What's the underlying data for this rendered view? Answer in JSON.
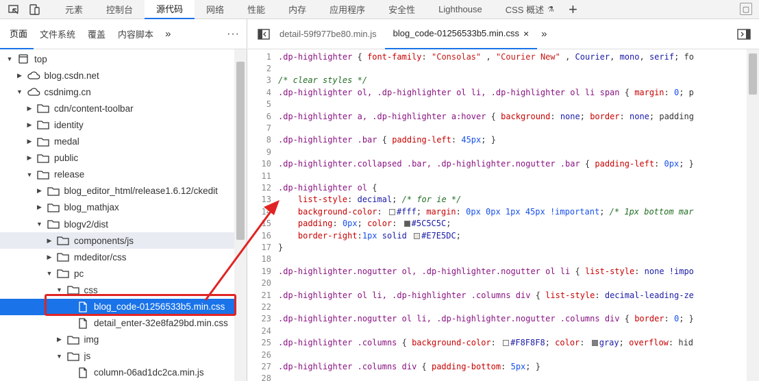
{
  "topbar": {
    "tabs": [
      "元素",
      "控制台",
      "源代码",
      "网络",
      "性能",
      "内存",
      "应用程序",
      "安全性",
      "Lighthouse",
      "CSS 概述"
    ],
    "active_tab": 2,
    "plus": "+"
  },
  "left": {
    "subtabs": [
      "页面",
      "文件系统",
      "覆盖",
      "内容脚本"
    ],
    "chevron": "»",
    "dots": "⋮"
  },
  "tree": [
    {
      "label": "top",
      "indent": 0,
      "tri": "open",
      "icon": "frame"
    },
    {
      "label": "blog.csdn.net",
      "indent": 1,
      "tri": "closed",
      "icon": "cloud"
    },
    {
      "label": "csdnimg.cn",
      "indent": 1,
      "tri": "open",
      "icon": "cloud"
    },
    {
      "label": "cdn/content-toolbar",
      "indent": 2,
      "tri": "closed",
      "icon": "folder"
    },
    {
      "label": "identity",
      "indent": 2,
      "tri": "closed",
      "icon": "folder"
    },
    {
      "label": "medal",
      "indent": 2,
      "tri": "closed",
      "icon": "folder"
    },
    {
      "label": "public",
      "indent": 2,
      "tri": "closed",
      "icon": "folder"
    },
    {
      "label": "release",
      "indent": 2,
      "tri": "open",
      "icon": "folder"
    },
    {
      "label": "blog_editor_html/release1.6.12/ckedit",
      "indent": 3,
      "tri": "closed",
      "icon": "folder"
    },
    {
      "label": "blog_mathjax",
      "indent": 3,
      "tri": "closed",
      "icon": "folder"
    },
    {
      "label": "blogv2/dist",
      "indent": 3,
      "tri": "open",
      "icon": "folder"
    },
    {
      "label": "components/js",
      "indent": 4,
      "tri": "closed",
      "icon": "folder",
      "state": "hl"
    },
    {
      "label": "mdeditor/css",
      "indent": 4,
      "tri": "closed",
      "icon": "folder"
    },
    {
      "label": "pc",
      "indent": 4,
      "tri": "open",
      "icon": "folder"
    },
    {
      "label": "css",
      "indent": 5,
      "tri": "open",
      "icon": "folder"
    },
    {
      "label": "blog_code-01256533b5.min.css",
      "indent": 6,
      "tri": "none",
      "icon": "file",
      "state": "sel"
    },
    {
      "label": "detail_enter-32e8fa29bd.min.css",
      "indent": 6,
      "tri": "none",
      "icon": "file"
    },
    {
      "label": "img",
      "indent": 5,
      "tri": "closed",
      "icon": "folder"
    },
    {
      "label": "js",
      "indent": 5,
      "tri": "open",
      "icon": "folder"
    },
    {
      "label": "column-06ad1dc2ca.min.js",
      "indent": 6,
      "tri": "none",
      "icon": "file"
    }
  ],
  "filetabs": {
    "inactive": "detail-59f977be80.min.js",
    "active": "blog_code-01256533b5.min.css",
    "close": "×",
    "chevron": "»"
  },
  "code_lines": [
    {
      "n": "1",
      "t": [
        [
          "sel-c",
          ".dp-highlighter"
        ],
        [
          "code",
          " { "
        ],
        [
          "prop",
          "font-family"
        ],
        [
          "code",
          ": "
        ],
        [
          "str",
          "\"Consolas\""
        ],
        [
          "code",
          " , "
        ],
        [
          "str",
          "\"Courier New\""
        ],
        [
          "code",
          " , "
        ],
        [
          "val",
          "Courier"
        ],
        [
          "code",
          ", "
        ],
        [
          "val",
          "mono"
        ],
        [
          "code",
          ", "
        ],
        [
          "val",
          "serif"
        ],
        [
          "code",
          "; fo"
        ]
      ]
    },
    {
      "n": "2",
      "t": []
    },
    {
      "n": "3",
      "t": [
        [
          "cmt",
          "/* clear styles */"
        ]
      ]
    },
    {
      "n": "4",
      "t": [
        [
          "sel-c",
          ".dp-highlighter ol, .dp-highlighter ol li, .dp-highlighter ol li span"
        ],
        [
          "code",
          " { "
        ],
        [
          "prop",
          "margin"
        ],
        [
          "code",
          ": "
        ],
        [
          "num",
          "0"
        ],
        [
          "code",
          "; p"
        ]
      ]
    },
    {
      "n": "5",
      "t": []
    },
    {
      "n": "6",
      "t": [
        [
          "sel-c",
          ".dp-highlighter a, .dp-highlighter a:hover"
        ],
        [
          "code",
          " { "
        ],
        [
          "prop",
          "background"
        ],
        [
          "code",
          ": "
        ],
        [
          "val",
          "none"
        ],
        [
          "code",
          "; "
        ],
        [
          "prop",
          "border"
        ],
        [
          "code",
          ": "
        ],
        [
          "val",
          "none"
        ],
        [
          "code",
          "; padding"
        ]
      ]
    },
    {
      "n": "7",
      "t": []
    },
    {
      "n": "8",
      "t": [
        [
          "sel-c",
          ".dp-highlighter .bar"
        ],
        [
          "code",
          " { "
        ],
        [
          "prop",
          "padding-left"
        ],
        [
          "code",
          ": "
        ],
        [
          "num",
          "45px"
        ],
        [
          "code",
          "; }"
        ]
      ]
    },
    {
      "n": "9",
      "t": []
    },
    {
      "n": "10",
      "t": [
        [
          "sel-c",
          ".dp-highlighter.collapsed .bar, .dp-highlighter.nogutter .bar"
        ],
        [
          "code",
          " { "
        ],
        [
          "prop",
          "padding-left"
        ],
        [
          "code",
          ": "
        ],
        [
          "num",
          "0px"
        ],
        [
          "code",
          "; }"
        ]
      ]
    },
    {
      "n": "11",
      "t": []
    },
    {
      "n": "12",
      "t": [
        [
          "sel-c",
          ".dp-highlighter ol"
        ],
        [
          "code",
          " {"
        ]
      ]
    },
    {
      "n": "13",
      "t": [
        [
          "code",
          "    "
        ],
        [
          "prop",
          "list-style"
        ],
        [
          "code",
          ": "
        ],
        [
          "val",
          "decimal"
        ],
        [
          "code",
          "; "
        ],
        [
          "cmt",
          "/* for ie */"
        ]
      ]
    },
    {
      "n": "14",
      "t": [
        [
          "code",
          "    "
        ],
        [
          "prop",
          "background-color"
        ],
        [
          "code",
          ": "
        ],
        [
          "sw",
          "#ffffff"
        ],
        [
          "val",
          "#fff"
        ],
        [
          "code",
          "; "
        ],
        [
          "prop",
          "margin"
        ],
        [
          "code",
          ": "
        ],
        [
          "num",
          "0px 0px 1px 45px !important"
        ],
        [
          "code",
          "; "
        ],
        [
          "cmt",
          "/* 1px bottom mar"
        ]
      ]
    },
    {
      "n": "15",
      "t": [
        [
          "code",
          "    "
        ],
        [
          "prop",
          "padding"
        ],
        [
          "code",
          ": "
        ],
        [
          "num",
          "0px"
        ],
        [
          "code",
          "; "
        ],
        [
          "prop",
          "color"
        ],
        [
          "code",
          ": "
        ],
        [
          "sw",
          "#5C5C5C"
        ],
        [
          "val",
          "#5C5C5C"
        ],
        [
          "code",
          ";"
        ]
      ]
    },
    {
      "n": "16",
      "t": [
        [
          "code",
          "    "
        ],
        [
          "prop",
          "border-right"
        ],
        [
          "code",
          ":"
        ],
        [
          "num",
          "1px"
        ],
        [
          "code",
          " "
        ],
        [
          "val",
          "solid"
        ],
        [
          "code",
          " "
        ],
        [
          "sw",
          "#E7E5DC"
        ],
        [
          "val",
          "#E7E5DC"
        ],
        [
          "code",
          ";"
        ]
      ]
    },
    {
      "n": "17",
      "t": [
        [
          "code",
          "}"
        ]
      ]
    },
    {
      "n": "18",
      "t": []
    },
    {
      "n": "19",
      "t": [
        [
          "sel-c",
          ".dp-highlighter.nogutter ol, .dp-highlighter.nogutter ol li"
        ],
        [
          "code",
          " { "
        ],
        [
          "prop",
          "list-style"
        ],
        [
          "code",
          ": "
        ],
        [
          "val",
          "none !impo"
        ]
      ]
    },
    {
      "n": "20",
      "t": []
    },
    {
      "n": "21",
      "t": [
        [
          "sel-c",
          ".dp-highlighter ol li, .dp-highlighter .columns div"
        ],
        [
          "code",
          " { "
        ],
        [
          "prop",
          "list-style"
        ],
        [
          "code",
          ": "
        ],
        [
          "val",
          "decimal-leading-ze"
        ]
      ]
    },
    {
      "n": "22",
      "t": []
    },
    {
      "n": "23",
      "t": [
        [
          "sel-c",
          ".dp-highlighter.nogutter ol li, .dp-highlighter.nogutter .columns div"
        ],
        [
          "code",
          " { "
        ],
        [
          "prop",
          "border"
        ],
        [
          "code",
          ": "
        ],
        [
          "num",
          "0"
        ],
        [
          "code",
          "; }"
        ]
      ]
    },
    {
      "n": "24",
      "t": []
    },
    {
      "n": "25",
      "t": [
        [
          "sel-c",
          ".dp-highlighter .columns"
        ],
        [
          "code",
          " { "
        ],
        [
          "prop",
          "background-color"
        ],
        [
          "code",
          ": "
        ],
        [
          "sw",
          "#F8F8F8"
        ],
        [
          "val",
          "#F8F8F8"
        ],
        [
          "code",
          "; "
        ],
        [
          "prop",
          "color"
        ],
        [
          "code",
          ": "
        ],
        [
          "sw",
          "#808080"
        ],
        [
          "val",
          "gray"
        ],
        [
          "code",
          "; "
        ],
        [
          "prop",
          "overflow"
        ],
        [
          "code",
          ": hid"
        ]
      ]
    },
    {
      "n": "26",
      "t": []
    },
    {
      "n": "27",
      "t": [
        [
          "sel-c",
          ".dp-highlighter .columns div"
        ],
        [
          "code",
          " { "
        ],
        [
          "prop",
          "padding-bottom"
        ],
        [
          "code",
          ": "
        ],
        [
          "num",
          "5px"
        ],
        [
          "code",
          "; }"
        ]
      ]
    },
    {
      "n": "28",
      "t": []
    }
  ],
  "colors": {
    "accent": "#1a73e8",
    "annotation": "#e02424"
  }
}
